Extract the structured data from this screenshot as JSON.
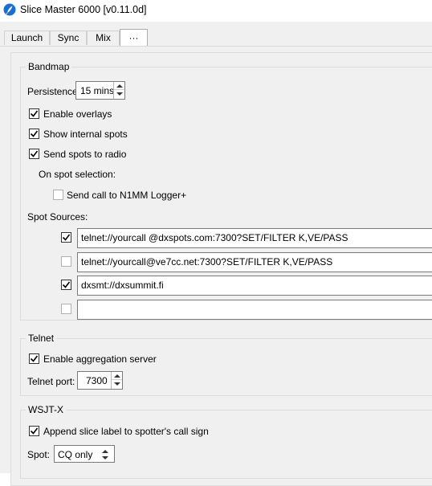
{
  "window": {
    "title": "Slice Master 6000 [v0.11.0d]",
    "icon": "feather-app-icon"
  },
  "tabs": [
    {
      "label": "Launch",
      "active": false
    },
    {
      "label": "Sync",
      "active": false
    },
    {
      "label": "Mix",
      "active": false
    },
    {
      "label": "···",
      "active": true
    }
  ],
  "bandmap": {
    "title": "Bandmap",
    "persistence_label": "Persistence",
    "persistence_value": "15 mins",
    "enable_overlays": {
      "label": "Enable overlays",
      "checked": true
    },
    "show_internal_spots": {
      "label": "Show internal spots",
      "checked": true
    },
    "send_spots_to_radio": {
      "label": "Send spots to radio",
      "checked": true
    },
    "on_spot_selection_label": "On spot selection:",
    "send_call_n1mm": {
      "label": "Send call to N1MM Logger+",
      "checked": false
    },
    "spot_sources_label": "Spot Sources:",
    "spot_sources": [
      {
        "checked": true,
        "value": "telnet://yourcall @dxspots.com:7300?SET/FILTER K,VE/PASS"
      },
      {
        "checked": false,
        "value": "telnet://yourcall@ve7cc.net:7300?SET/FILTER K,VE/PASS"
      },
      {
        "checked": true,
        "value": "dxsmt://dxsummit.fi"
      },
      {
        "checked": false,
        "value": ""
      }
    ]
  },
  "telnet": {
    "title": "Telnet",
    "enable_aggregation": {
      "label": "Enable aggregation  server",
      "checked": true
    },
    "port_label": "Telnet port:",
    "port_value": "7300"
  },
  "wsjtx": {
    "title": "WSJT-X",
    "append_label": {
      "label": "Append slice label to spotter's call sign",
      "checked": true
    },
    "spot_label": "Spot:",
    "spot_value": "CQ only"
  },
  "colors": {
    "accent": "#1a6fd1",
    "panel": "#f0f0f0",
    "border": "#dcdcdc"
  }
}
